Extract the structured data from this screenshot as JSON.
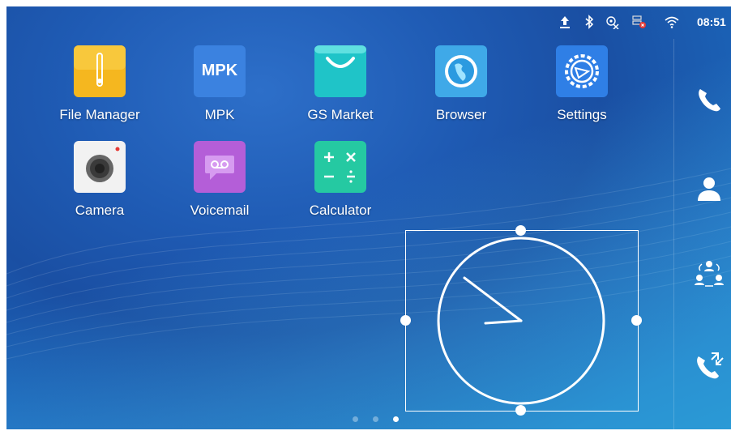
{
  "status_bar": {
    "time": "08:51",
    "icons": [
      "upload-icon",
      "bluetooth-icon",
      "account-blocked-icon",
      "network-error-icon",
      "wifi-icon"
    ]
  },
  "apps": [
    {
      "label": "File Manager",
      "icon": "file-manager-icon"
    },
    {
      "label": "MPK",
      "icon": "mpk-icon",
      "icon_text": "MPK"
    },
    {
      "label": "GS Market",
      "icon": "gs-market-icon"
    },
    {
      "label": "Browser",
      "icon": "browser-icon"
    },
    {
      "label": "Settings",
      "icon": "settings-icon"
    },
    {
      "label": "Camera",
      "icon": "camera-icon"
    },
    {
      "label": "Voicemail",
      "icon": "voicemail-icon"
    },
    {
      "label": "Calculator",
      "icon": "calculator-icon"
    }
  ],
  "dock": [
    "phone-icon",
    "contacts-icon",
    "conference-icon",
    "call-history-icon"
  ],
  "clock_widget": {
    "type": "analog",
    "selected": true
  },
  "pagination": {
    "pages": 3,
    "current": 3
  },
  "colors": {
    "background": "#1f5bb4",
    "file_manager": "#f5b71f",
    "mpk": "#3b82e0",
    "gs_market": "#1fc4c8",
    "browser": "#3fa9e8",
    "settings": "#2f7fe6",
    "camera": "#f2f2f2",
    "voicemail": "#b45ed8",
    "calculator": "#25c9a2"
  }
}
